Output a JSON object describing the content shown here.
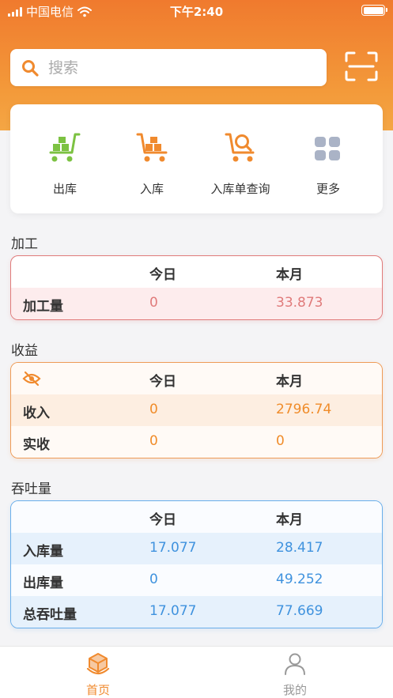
{
  "status_bar": {
    "carrier": "中国电信",
    "time": "下午2:40"
  },
  "search": {
    "placeholder": "搜索"
  },
  "quick_actions": [
    {
      "label": "出库",
      "icon": "cart-boxes-green-icon"
    },
    {
      "label": "入库",
      "icon": "cart-boxes-orange-icon"
    },
    {
      "label": "入库单查询",
      "icon": "cart-search-icon"
    },
    {
      "label": "更多",
      "icon": "grid-more-icon"
    }
  ],
  "processing": {
    "title": "加工",
    "header": {
      "today": "今日",
      "month": "本月"
    },
    "rows": [
      {
        "label": "加工量",
        "today": "0",
        "month": "33.873"
      }
    ]
  },
  "income": {
    "title": "收益",
    "header": {
      "today": "今日",
      "month": "本月"
    },
    "rows": [
      {
        "label": "收入",
        "today": "0",
        "month": "2796.74"
      },
      {
        "label": "实收",
        "today": "0",
        "month": "0"
      }
    ]
  },
  "throughput": {
    "title": "吞吐量",
    "header": {
      "today": "今日",
      "month": "本月"
    },
    "rows": [
      {
        "label": "入库量",
        "today": "17.077",
        "month": "28.417"
      },
      {
        "label": "出库量",
        "today": "0",
        "month": "49.252"
      },
      {
        "label": "总吞吐量",
        "today": "17.077",
        "month": "77.669"
      }
    ]
  },
  "tabbar": [
    {
      "label": "首页",
      "active": true
    },
    {
      "label": "我的",
      "active": false
    }
  ],
  "colors": {
    "accent": "#f08a2e",
    "processing": "#e07b7b",
    "income": "#f08c2a",
    "throughput": "#3f92de"
  }
}
